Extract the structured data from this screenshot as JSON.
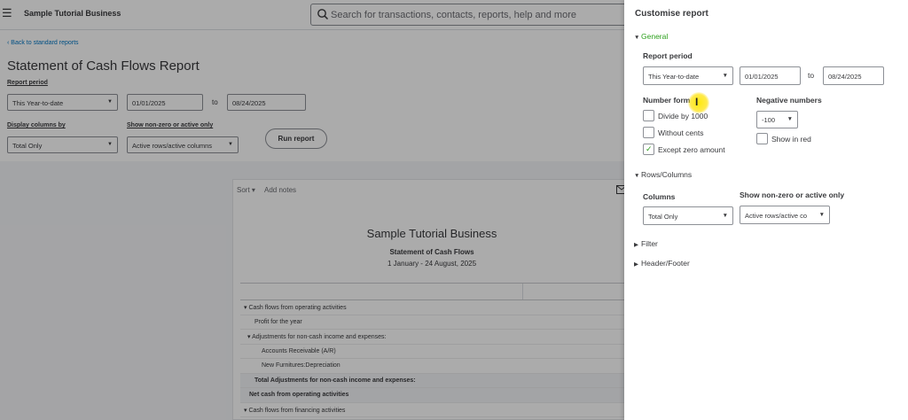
{
  "topbar": {
    "menu_icon": "menu-icon",
    "company": "Sample Tutorial Business",
    "search_placeholder": "Search for transactions, contacts, reports, help and more"
  },
  "page": {
    "back_link": "Back to standard reports",
    "title": "Statement of Cash Flows Report",
    "report_period_label": "Report period",
    "period_value": "This Year-to-date",
    "from_date": "01/01/2025",
    "to_label": "to",
    "to_date": "08/24/2025",
    "display_columns_label": "Display columns by",
    "display_columns_value": "Total Only",
    "non_zero_label": "Show non-zero or active only",
    "non_zero_value": "Active rows/active columns",
    "run_report": "Run report"
  },
  "report": {
    "sort": "Sort",
    "add_notes": "Add notes",
    "company": "Sample Tutorial Business",
    "title": "Statement of Cash Flows",
    "date_range": "1 January - 24 August, 2025",
    "rows": [
      {
        "text": "Cash flows from operating activities"
      },
      {
        "text": "Profit for the year"
      },
      {
        "text": "Adjustments for non-cash income and expenses:"
      },
      {
        "text": "Accounts Receivable (A/R)"
      },
      {
        "text": "New Furnitures:Depreciation"
      },
      {
        "text": "Total Adjustments for non-cash income and expenses:"
      },
      {
        "text": "Net cash from operating activities"
      },
      {
        "text": "Cash flows from financing activities"
      }
    ]
  },
  "panel": {
    "title": "Customise report",
    "general": "General",
    "report_period_label": "Report period",
    "period_value": "This Year-to-date",
    "from_date": "01/01/2025",
    "to_label": "to",
    "to_date": "08/24/2025",
    "number_format_label": "Number form",
    "divide_label": "Divide by 1000",
    "without_cents_label": "Without cents",
    "except_zero_label": "Except zero amount",
    "negative_label": "Negative numbers",
    "negative_value": "-100",
    "show_red_label": "Show in red",
    "rows_columns": "Rows/Columns",
    "columns_label": "Columns",
    "columns_value": "Total Only",
    "non_zero_label": "Show non-zero or active only",
    "non_zero_value": "Active rows/active co",
    "filter": "Filter",
    "header_footer": "Header/Footer"
  },
  "colors": {
    "accent_green": "#2ca01c",
    "link_blue": "#0077c5",
    "text": "#393a3d"
  }
}
